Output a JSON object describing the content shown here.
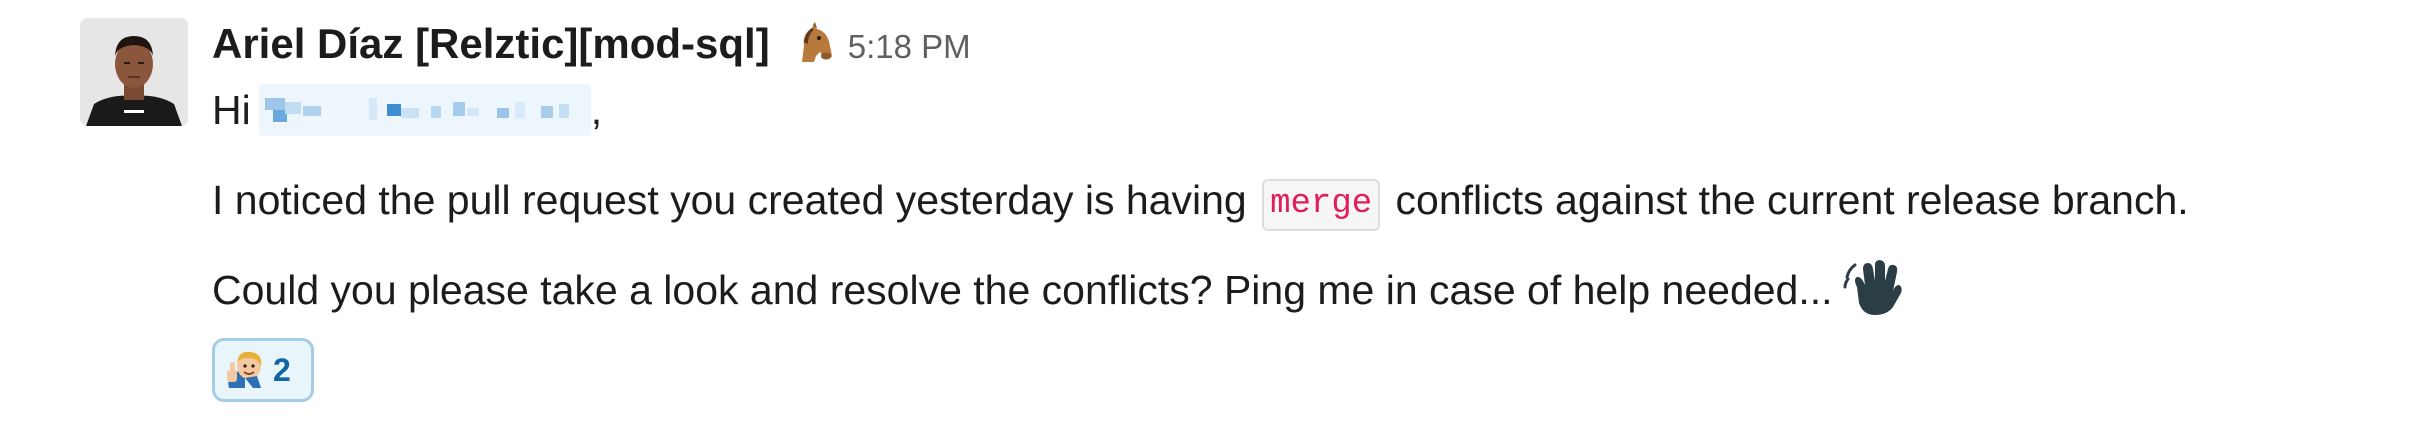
{
  "message": {
    "sender": "Ariel Díaz [Relztic][mod-sql]",
    "status_emoji": "horse-face-icon",
    "timestamp": "5:18 PM",
    "greeting": "Hi",
    "greeting_suffix": ",",
    "line2_before": "I noticed the pull request you created yesterday is having ",
    "line2_code": "merge",
    "line2_after": " conflicts against the current release branch.",
    "line3": "Could you please take a look and resolve the conflicts? Ping me in case of help needed...",
    "line3_emoji": "waving-hand-icon"
  },
  "reaction": {
    "emoji": "thumbs-up-character-icon",
    "count": "2"
  },
  "colors": {
    "text": "#1d1c1d",
    "timestamp": "#616061",
    "code_text": "#e01e5a",
    "reaction_bg": "#e8f5fa",
    "reaction_border": "#a4cde5",
    "reaction_count": "#1264a3",
    "mention_blur": "#eef6fd"
  }
}
